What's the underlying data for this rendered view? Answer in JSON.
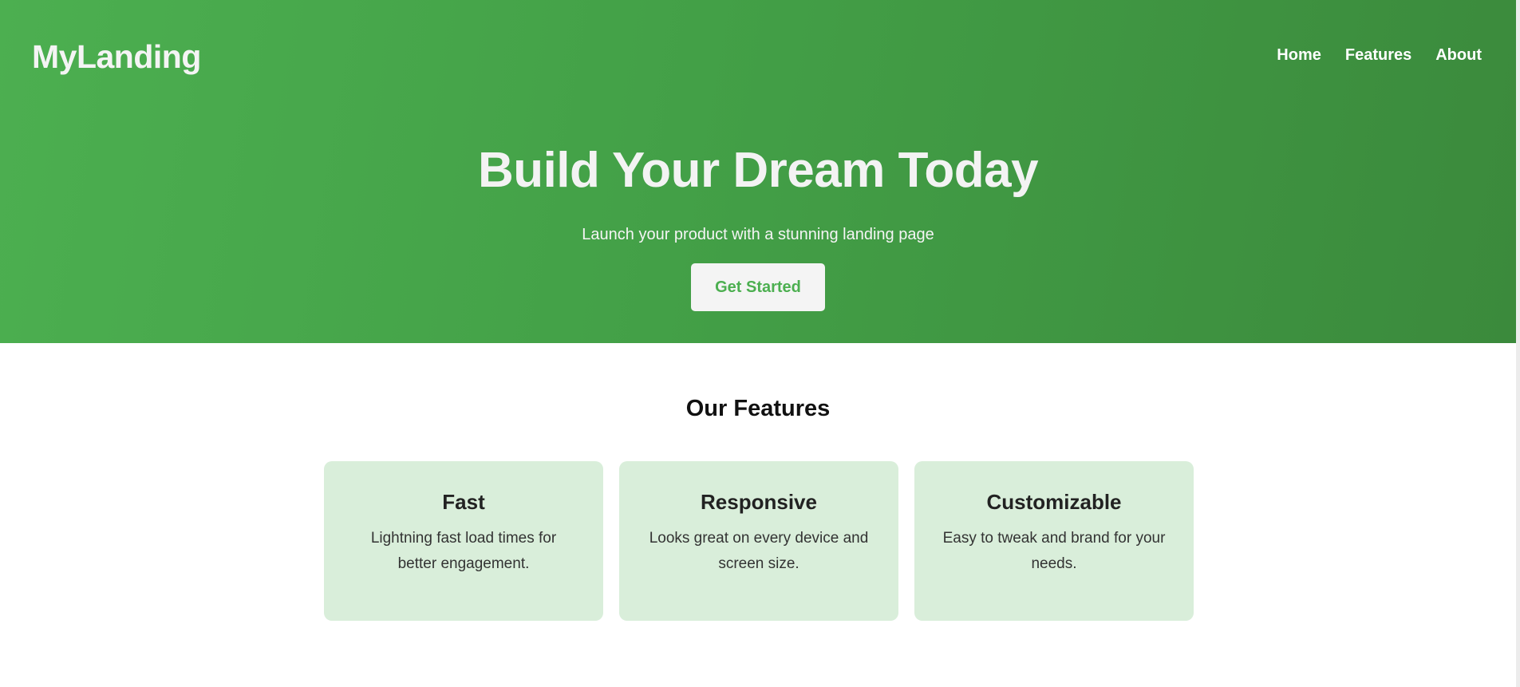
{
  "header": {
    "brand": "MyLanding",
    "nav": [
      "Home",
      "Features",
      "About"
    ]
  },
  "hero": {
    "title": "Build Your Dream Today",
    "subtitle": "Launch your product with a stunning landing page",
    "cta_label": "Get Started"
  },
  "features": {
    "title": "Our Features",
    "cards": [
      {
        "title": "Fast",
        "description": "Lightning fast load times for better engagement."
      },
      {
        "title": "Responsive",
        "description": "Looks great on every device and screen size."
      },
      {
        "title": "Customizable",
        "description": "Easy to tweak and brand for your needs."
      }
    ]
  },
  "colors": {
    "brand_green": "#4caf50",
    "dark_green": "#3b8a3c",
    "card_bg": "#d9eeda"
  }
}
